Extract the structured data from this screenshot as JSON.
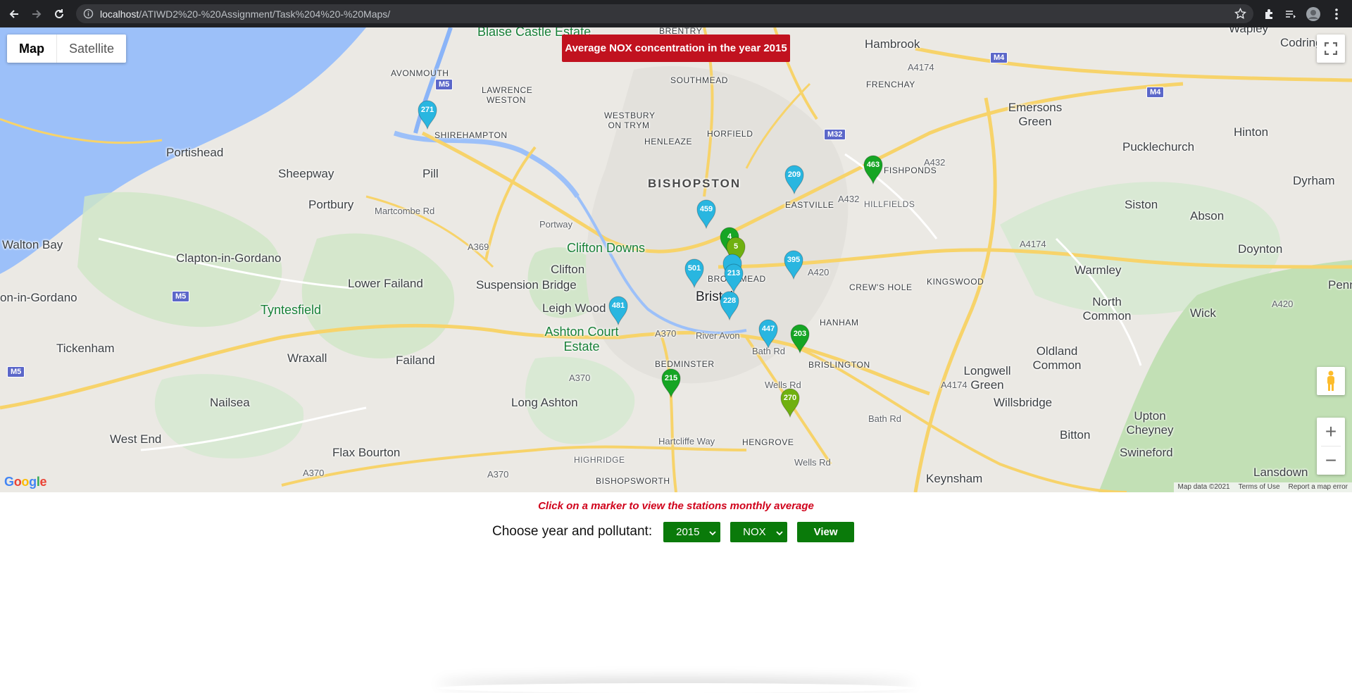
{
  "browser": {
    "url_host": "localhost",
    "url_path": "/ATIWD2%20-%20Assignment/Task%204%20-%20Maps/"
  },
  "map": {
    "map_type_options": [
      "Map",
      "Satellite"
    ],
    "active_map_type": "Map",
    "title": "Average NOX concentration in the year 2015",
    "attribution": [
      "Map data ©2021",
      "Terms of Use",
      "Report a map error"
    ],
    "logo": "Google",
    "places": [
      "Blaise Castle Estate",
      "BRENTRY",
      "Hambrook",
      "Wapley",
      "Codrington",
      "AVONMOUTH",
      "LAWRENCE WESTON",
      "SOUTHMEAD",
      "FRENCHAY",
      "Emersons Green",
      "SHIREHAMPTON",
      "WESTBURY ON TRYM",
      "HENLEAZE",
      "HORFIELD",
      "Hinton",
      "Portishead",
      "Pucklechurch",
      "Sheepway",
      "Pill",
      "BISHOPSTON",
      "FISHPONDS",
      "Dyrham",
      "Portbury",
      "EASTVILLE",
      "HILLFIELDS",
      "Siston",
      "Abson",
      "Walton Bay",
      "Clifton Downs",
      "Doynton",
      "Clapton-in-Gordano",
      "Warmley",
      "Lower Failand",
      "Suspension Bridge",
      "Clifton",
      "CREW'S HOLE",
      "KINGSWOOD",
      "on-in-Gordano",
      "Tyntesfield",
      "Leigh Wood",
      "Bristol",
      "North Common",
      "Wick",
      "Penns",
      "Ashton Court Estate",
      "HANHAM",
      "Oldland Common",
      "Tickenham",
      "Wraxall",
      "Failand",
      "BEDMINSTER",
      "BRISLINGTON",
      "Longwell Green",
      "Nailsea",
      "Long Ashton",
      "Willsbridge",
      "Upton Cheyney",
      "West End",
      "Bitton",
      "Swineford",
      "Flax Bourton",
      "HIGHRIDGE",
      "HENGROVE",
      "BISHOPSWORTH",
      "Keynsham",
      "Lansdown",
      "BROADMEAD",
      "River Avon"
    ],
    "roads": [
      "M5",
      "M4",
      "M32",
      "A4174",
      "A432",
      "A369",
      "A370",
      "A420",
      "A4",
      "Martcombe Rd",
      "Portway",
      "Bath Rd",
      "Wells Rd",
      "Hartcliffe Way"
    ],
    "markers": [
      {
        "value": "271",
        "color": "#29b6e0"
      },
      {
        "value": "459",
        "color": "#29b6e0"
      },
      {
        "value": "209",
        "color": "#29b6e0"
      },
      {
        "value": "463",
        "color": "#16a524"
      },
      {
        "value": "4",
        "color": "#16a524"
      },
      {
        "value": "5",
        "color": "#6fb010"
      },
      {
        "value": "",
        "color": "#29b6e0"
      },
      {
        "value": "213",
        "color": "#29b6e0"
      },
      {
        "value": "501",
        "color": "#29b6e0"
      },
      {
        "value": "395",
        "color": "#29b6e0"
      },
      {
        "value": "228",
        "color": "#29b6e0"
      },
      {
        "value": "481",
        "color": "#29b6e0"
      },
      {
        "value": "447",
        "color": "#29b6e0"
      },
      {
        "value": "203",
        "color": "#16a524"
      },
      {
        "value": "215",
        "color": "#16a524"
      },
      {
        "value": "270",
        "color": "#6fb010"
      }
    ]
  },
  "hint": "Click on a marker to view the stations monthly average",
  "controls": {
    "label": "Choose year and pollutant:",
    "year": "2015",
    "pollutant": "NOX",
    "view_label": "View"
  }
}
